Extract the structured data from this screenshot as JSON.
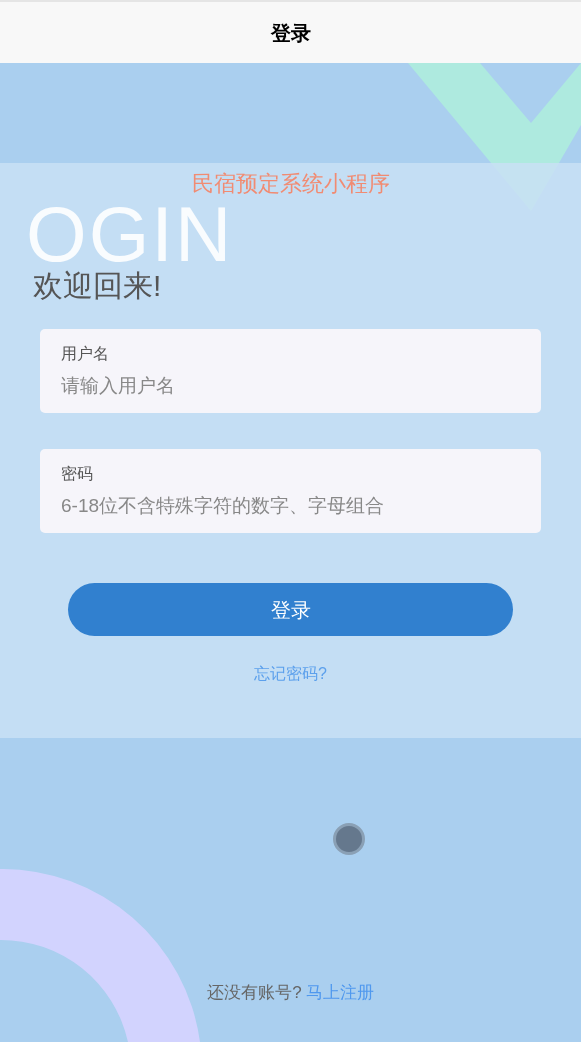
{
  "header": {
    "title": "登录"
  },
  "app_title": "民宿预定系统小程序",
  "backdrop_word": "OGIN",
  "welcome": "欢迎回来!",
  "fields": [
    {
      "label": "用户名",
      "placeholder": "请输入用户名"
    },
    {
      "label": "密码",
      "placeholder": "6-18位不含特殊字符的数字、字母组合"
    }
  ],
  "login_button": "登录",
  "forgot_link": "忘记密码?",
  "register": {
    "prompt": "还没有账号?",
    "link": "马上注册"
  }
}
